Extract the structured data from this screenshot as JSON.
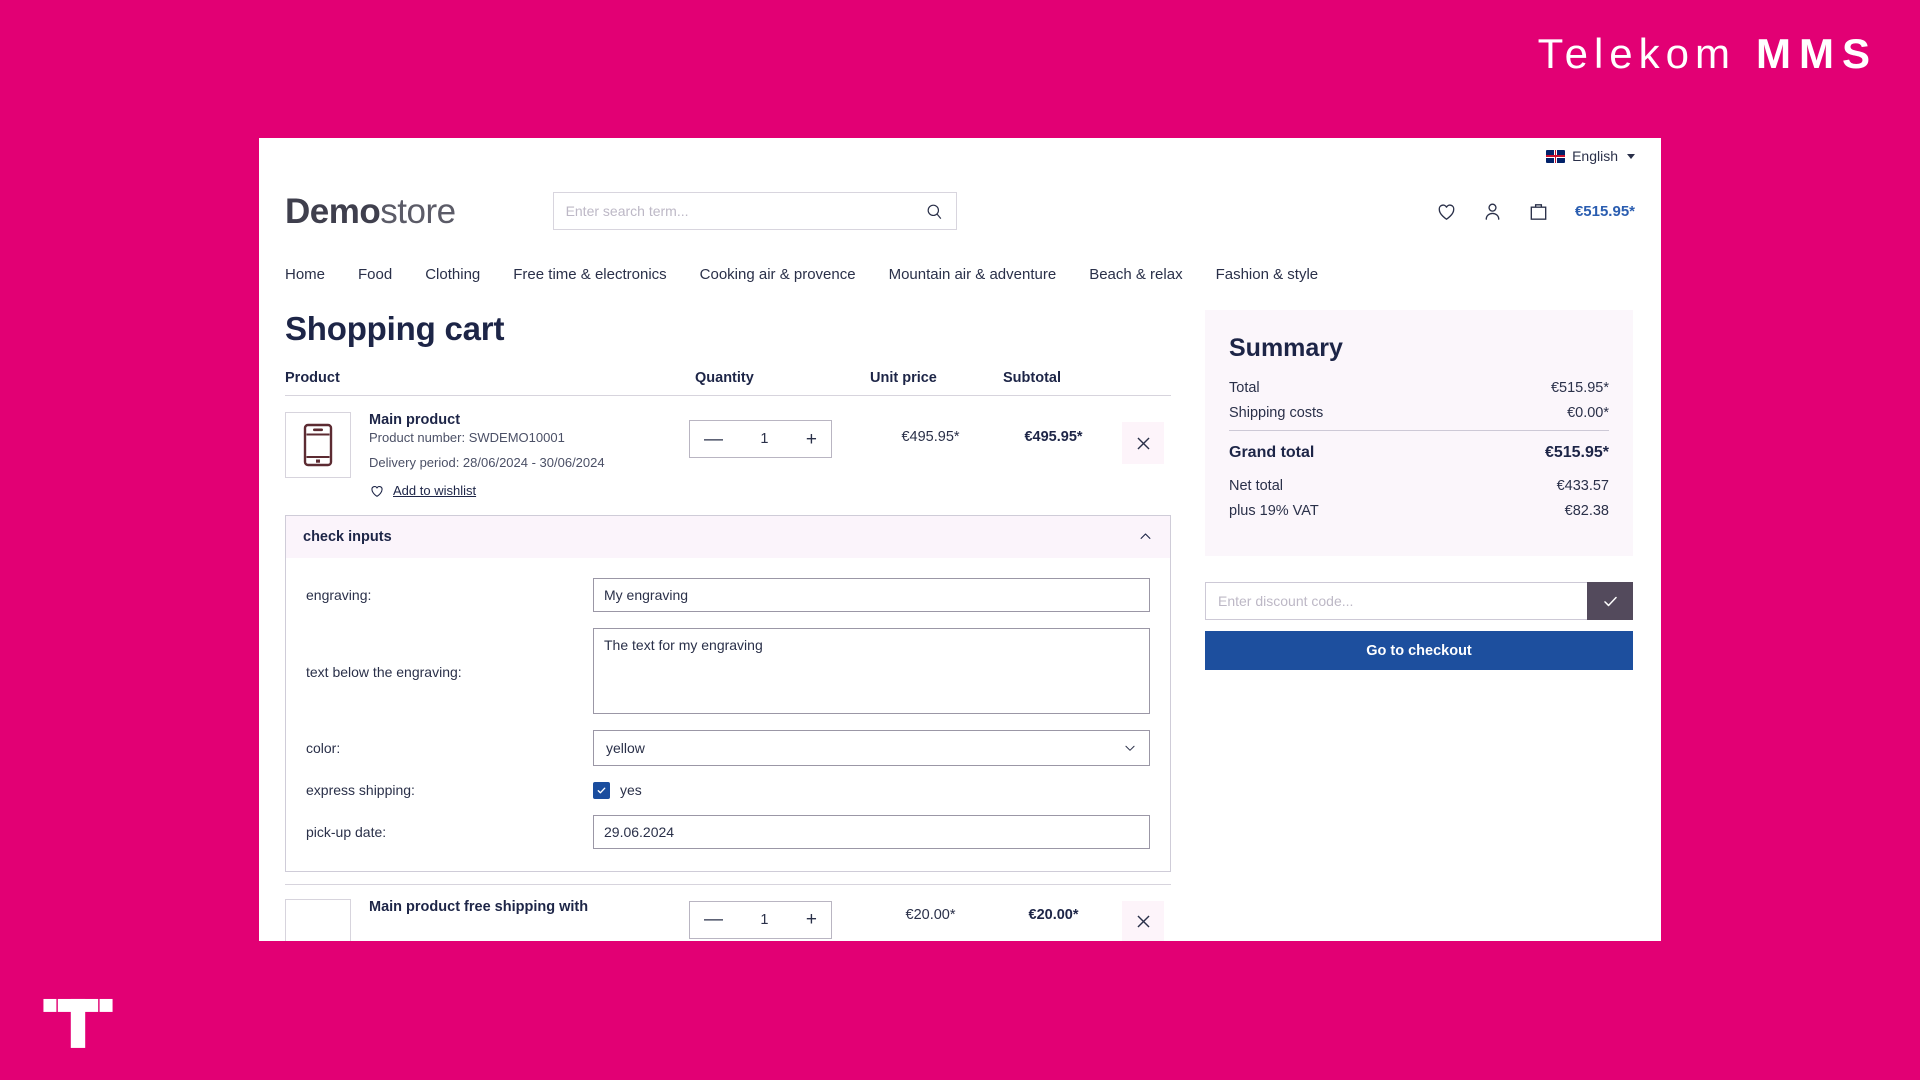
{
  "brand": {
    "name_top": "Telekom",
    "name_mms": "MMS",
    "accent_color": "#e20074",
    "logo_t_name": "telekom-t-logo"
  },
  "topbar": {
    "language": "English",
    "flag": "uk-flag-icon",
    "caret": "chevron-down-icon"
  },
  "header": {
    "logo_bold": "Demo",
    "logo_light": "store",
    "search_placeholder": "Enter search term...",
    "search_value": "",
    "search_icon": "search-icon",
    "wishlist_icon": "heart-icon",
    "account_icon": "person-icon",
    "cart_icon": "bag-icon",
    "cart_total": "€515.95*",
    "cart_total_color": "#2a5db0"
  },
  "nav": {
    "items": [
      "Home",
      "Food",
      "Clothing",
      "Free time & electronics",
      "Cooking air & provence",
      "Mountain air & adventure",
      "Beach & relax",
      "Fashion & style"
    ]
  },
  "cart": {
    "title": "Shopping cart",
    "columns": {
      "product": "Product",
      "quantity": "Quantity",
      "unit_price": "Unit price",
      "subtotal": "Subtotal"
    },
    "rows": [
      {
        "thumb_icon": "smartphone-icon",
        "name": "Main product",
        "product_number_label": "Product number: SWDEMO10001",
        "delivery_period": "Delivery period: 28/06/2024 - 30/06/2024",
        "wishlist_label": "Add to wishlist",
        "qty_minus": "—",
        "qty_value": "1",
        "qty_plus": "+",
        "unit_price": "€495.95*",
        "subtotal": "€495.95*",
        "remove_icon": "close-icon"
      },
      {
        "name": "Main product free shipping with",
        "unit_price": "€20.00*",
        "subtotal": "€20.00*",
        "qty_value": "1"
      }
    ]
  },
  "check_inputs": {
    "header": "check inputs",
    "collapse_icon": "chevron-up-icon",
    "fields": [
      {
        "label": "engraving:",
        "type": "text",
        "value": "My engraving"
      },
      {
        "label": "text below the engraving:",
        "type": "textarea",
        "value": "The text for my engraving"
      },
      {
        "label": "color:",
        "type": "select",
        "value": "yellow"
      },
      {
        "label": "express shipping:",
        "type": "checkbox",
        "value": "yes",
        "checked": true
      },
      {
        "label": "pick-up date:",
        "type": "text",
        "value": "29.06.2024"
      }
    ]
  },
  "summary": {
    "title": "Summary",
    "total_label": "Total",
    "total_value": "€515.95*",
    "shipping_label": "Shipping costs",
    "shipping_value": "€0.00*",
    "grand_label": "Grand total",
    "grand_value": "€515.95*",
    "net_label": "Net total",
    "net_value": "€433.57",
    "vat_label": "plus 19% VAT",
    "vat_value": "€82.38",
    "discount_placeholder": "Enter discount code...",
    "discount_value": "",
    "discount_apply_icon": "check-icon",
    "checkout_label": "Go to checkout",
    "checkout_color": "#1d4f9e"
  }
}
